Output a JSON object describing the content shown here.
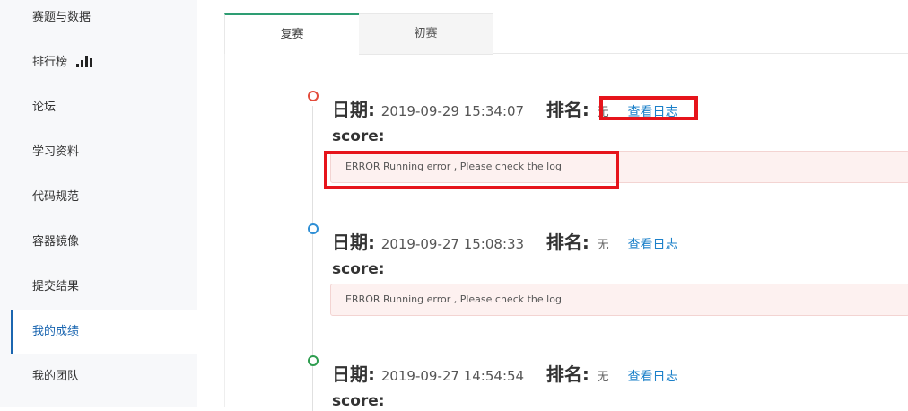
{
  "sidebar": {
    "items": [
      {
        "label": "赛题与数据"
      },
      {
        "label": "排行榜",
        "icon": "bar-chart-icon"
      },
      {
        "label": "论坛"
      },
      {
        "label": "学习资料"
      },
      {
        "label": "代码规范"
      },
      {
        "label": "容器镜像"
      },
      {
        "label": "提交结果"
      },
      {
        "label": "我的成绩",
        "active": true
      },
      {
        "label": "我的团队"
      }
    ]
  },
  "tabs": [
    {
      "label": "复赛",
      "active": true
    },
    {
      "label": "初赛",
      "active": false
    }
  ],
  "labels": {
    "date_key": "日期:",
    "rank_key": "排名:",
    "view_log": "查看日志",
    "score": "score:"
  },
  "records": [
    {
      "date": "2019-09-29 15:34:07",
      "rank": "无",
      "dot_color": "#e34c3c",
      "error": "ERROR Running error , Please check the log"
    },
    {
      "date": "2019-09-27 15:08:33",
      "rank": "无",
      "dot_color": "#2f8fd5",
      "error": "ERROR Running error , Please check the log"
    },
    {
      "date": "2019-09-27 14:54:54",
      "rank": "无",
      "dot_color": "#2e9d4f",
      "error": ""
    }
  ],
  "colors": {
    "highlight": "#e6141b",
    "link": "#1b80c9",
    "active_nav": "#1b66b0"
  }
}
